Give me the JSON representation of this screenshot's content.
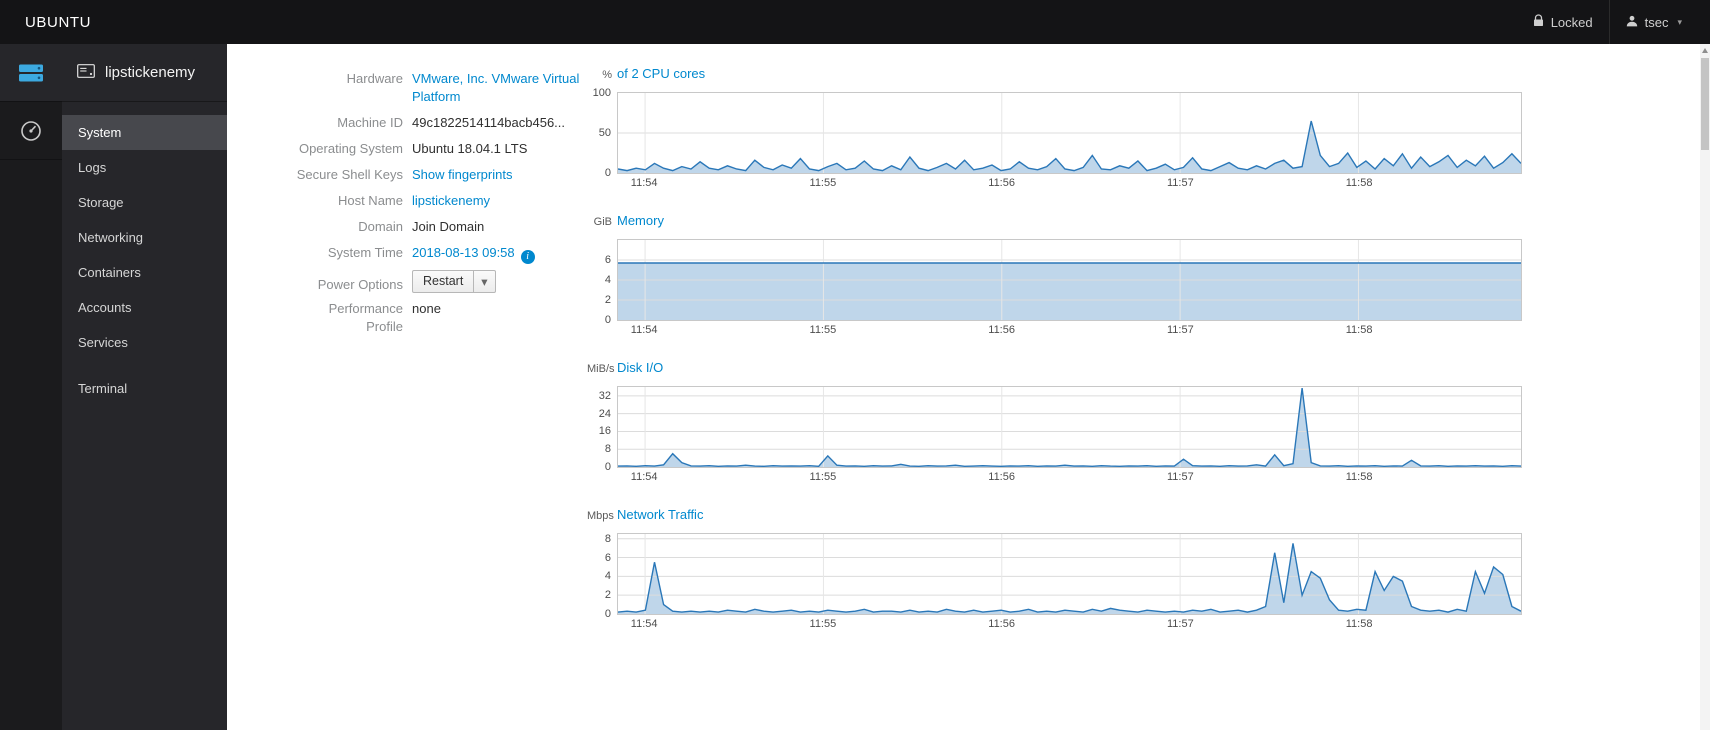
{
  "topbar": {
    "brand": "UBUNTU",
    "locked_label": "Locked",
    "user_name": "tsec"
  },
  "sidebar": {
    "host_name": "lipstickenemy",
    "items": [
      {
        "label": "System"
      },
      {
        "label": "Logs"
      },
      {
        "label": "Storage"
      },
      {
        "label": "Networking"
      },
      {
        "label": "Containers"
      },
      {
        "label": "Accounts"
      },
      {
        "label": "Services"
      },
      {
        "label": "Terminal"
      }
    ]
  },
  "info": {
    "hardware_label": "Hardware",
    "hardware_value": "VMware, Inc. VMware Virtual Platform",
    "machine_id_label": "Machine ID",
    "machine_id_value": "49c1822514114bacb456...",
    "os_label": "Operating System",
    "os_value": "Ubuntu 18.04.1 LTS",
    "ssh_label": "Secure Shell Keys",
    "ssh_value": "Show fingerprints",
    "hostname_label": "Host Name",
    "hostname_value": "lipstickenemy",
    "domain_label": "Domain",
    "domain_value": "Join Domain",
    "time_label": "System Time",
    "time_value": "2018-08-13 09:58",
    "time_info_icon": "i",
    "power_label": "Power Options",
    "power_button_label": "Restart",
    "profile_label": "Performance Profile",
    "profile_value": "none"
  },
  "colors": {
    "link": "#0088ce",
    "chart_line": "#2a77b8",
    "chart_fill": "rgba(42,119,184,0.30)",
    "grid_h": "#dcdcdc",
    "grid_v": "#e6e6e6",
    "accent": "#3ca9e0"
  },
  "chart_data": [
    {
      "type": "area",
      "title": "of 2 CPU cores",
      "unit": "%",
      "ylim": [
        0,
        100
      ],
      "yticks": [
        0,
        50,
        100
      ],
      "xticks": [
        "11:54",
        "11:55",
        "11:56",
        "11:57",
        "11:58"
      ],
      "xtick_pos": [
        0.03,
        0.2275,
        0.425,
        0.6225,
        0.82
      ],
      "values": [
        5,
        3,
        6,
        4,
        12,
        6,
        3,
        8,
        5,
        14,
        6,
        4,
        9,
        5,
        3,
        16,
        7,
        4,
        10,
        6,
        18,
        5,
        3,
        8,
        12,
        4,
        6,
        15,
        5,
        3,
        9,
        4,
        20,
        6,
        3,
        7,
        12,
        5,
        16,
        4,
        6,
        10,
        3,
        5,
        14,
        6,
        4,
        8,
        18,
        5,
        3,
        7,
        22,
        5,
        4,
        9,
        6,
        15,
        3,
        6,
        11,
        4,
        7,
        19,
        5,
        3,
        8,
        13,
        6,
        4,
        9,
        5,
        12,
        16,
        6,
        8,
        65,
        22,
        8,
        12,
        25,
        7,
        15,
        5,
        18,
        9,
        24,
        6,
        20,
        8,
        14,
        22,
        7,
        16,
        9,
        21,
        6,
        13,
        24,
        12
      ]
    },
    {
      "type": "area",
      "title": "Memory",
      "unit": "GiB",
      "ylim": [
        0,
        8
      ],
      "yticks": [
        0,
        2,
        4,
        6
      ],
      "xticks": [
        "11:54",
        "11:55",
        "11:56",
        "11:57",
        "11:58"
      ],
      "xtick_pos": [
        0.03,
        0.2275,
        0.425,
        0.6225,
        0.82
      ],
      "values": [
        5.7,
        5.7,
        5.7,
        5.7,
        5.7,
        5.7,
        5.7,
        5.7,
        5.7,
        5.7,
        5.7,
        5.7,
        5.7,
        5.7,
        5.7,
        5.7,
        5.7,
        5.7,
        5.7,
        5.7
      ]
    },
    {
      "type": "area",
      "title": "Disk I/O",
      "unit": "MiB/s",
      "ylim": [
        0,
        36
      ],
      "yticks": [
        0,
        8,
        16,
        24,
        32
      ],
      "xticks": [
        "11:54",
        "11:55",
        "11:56",
        "11:57",
        "11:58"
      ],
      "xtick_pos": [
        0.03,
        0.2275,
        0.425,
        0.6225,
        0.82
      ],
      "values": [
        0.4,
        0.5,
        0.3,
        0.6,
        0.4,
        1.0,
        6.0,
        2.0,
        0.5,
        0.4,
        0.6,
        0.3,
        0.5,
        0.4,
        0.8,
        0.4,
        0.3,
        0.6,
        0.4,
        0.5,
        0.4,
        0.6,
        0.3,
        5.0,
        0.8,
        0.4,
        0.5,
        0.3,
        0.6,
        0.4,
        0.5,
        1.2,
        0.4,
        0.3,
        0.6,
        0.4,
        0.5,
        0.8,
        0.3,
        0.4,
        0.6,
        0.4,
        0.3,
        0.5,
        0.4,
        0.6,
        0.3,
        0.5,
        0.4,
        0.8,
        0.4,
        0.5,
        0.3,
        0.6,
        0.4,
        0.3,
        0.5,
        0.4,
        0.6,
        0.3,
        0.5,
        0.4,
        3.5,
        0.6,
        0.4,
        0.5,
        0.3,
        0.6,
        0.4,
        0.5,
        1.0,
        0.4,
        5.5,
        0.6,
        1.5,
        35.5,
        2.0,
        0.5,
        0.4,
        0.6,
        0.3,
        0.5,
        0.4,
        0.6,
        0.3,
        0.5,
        0.4,
        3.0,
        0.5,
        0.4,
        0.6,
        0.3,
        0.5,
        0.4,
        0.6,
        0.4,
        0.5,
        0.3,
        0.6,
        0.4
      ]
    },
    {
      "type": "area",
      "title": "Network Traffic",
      "unit": "Mbps",
      "ylim": [
        0,
        8.5
      ],
      "yticks": [
        0,
        2,
        4,
        6,
        8
      ],
      "xticks": [
        "11:54",
        "11:55",
        "11:56",
        "11:57",
        "11:58"
      ],
      "xtick_pos": [
        0.03,
        0.2275,
        0.425,
        0.6225,
        0.82
      ],
      "values": [
        0.2,
        0.3,
        0.2,
        0.4,
        5.5,
        1.0,
        0.3,
        0.2,
        0.3,
        0.2,
        0.3,
        0.2,
        0.4,
        0.3,
        0.2,
        0.5,
        0.3,
        0.2,
        0.3,
        0.4,
        0.2,
        0.3,
        0.2,
        0.4,
        0.3,
        0.2,
        0.3,
        0.5,
        0.2,
        0.3,
        0.3,
        0.2,
        0.4,
        0.2,
        0.3,
        0.2,
        0.5,
        0.3,
        0.2,
        0.4,
        0.2,
        0.3,
        0.4,
        0.2,
        0.3,
        0.5,
        0.2,
        0.3,
        0.2,
        0.4,
        0.3,
        0.2,
        0.5,
        0.3,
        0.6,
        0.4,
        0.3,
        0.2,
        0.4,
        0.3,
        0.2,
        0.3,
        0.2,
        0.4,
        0.3,
        0.5,
        0.2,
        0.3,
        0.4,
        0.2,
        0.4,
        0.8,
        6.5,
        1.2,
        7.5,
        2.0,
        4.5,
        3.8,
        1.5,
        0.4,
        0.3,
        0.5,
        0.4,
        4.5,
        2.5,
        4.0,
        3.5,
        0.8,
        0.4,
        0.3,
        0.4,
        0.2,
        0.5,
        0.3,
        4.5,
        2.2,
        5.0,
        4.2,
        0.8,
        0.3
      ]
    }
  ]
}
